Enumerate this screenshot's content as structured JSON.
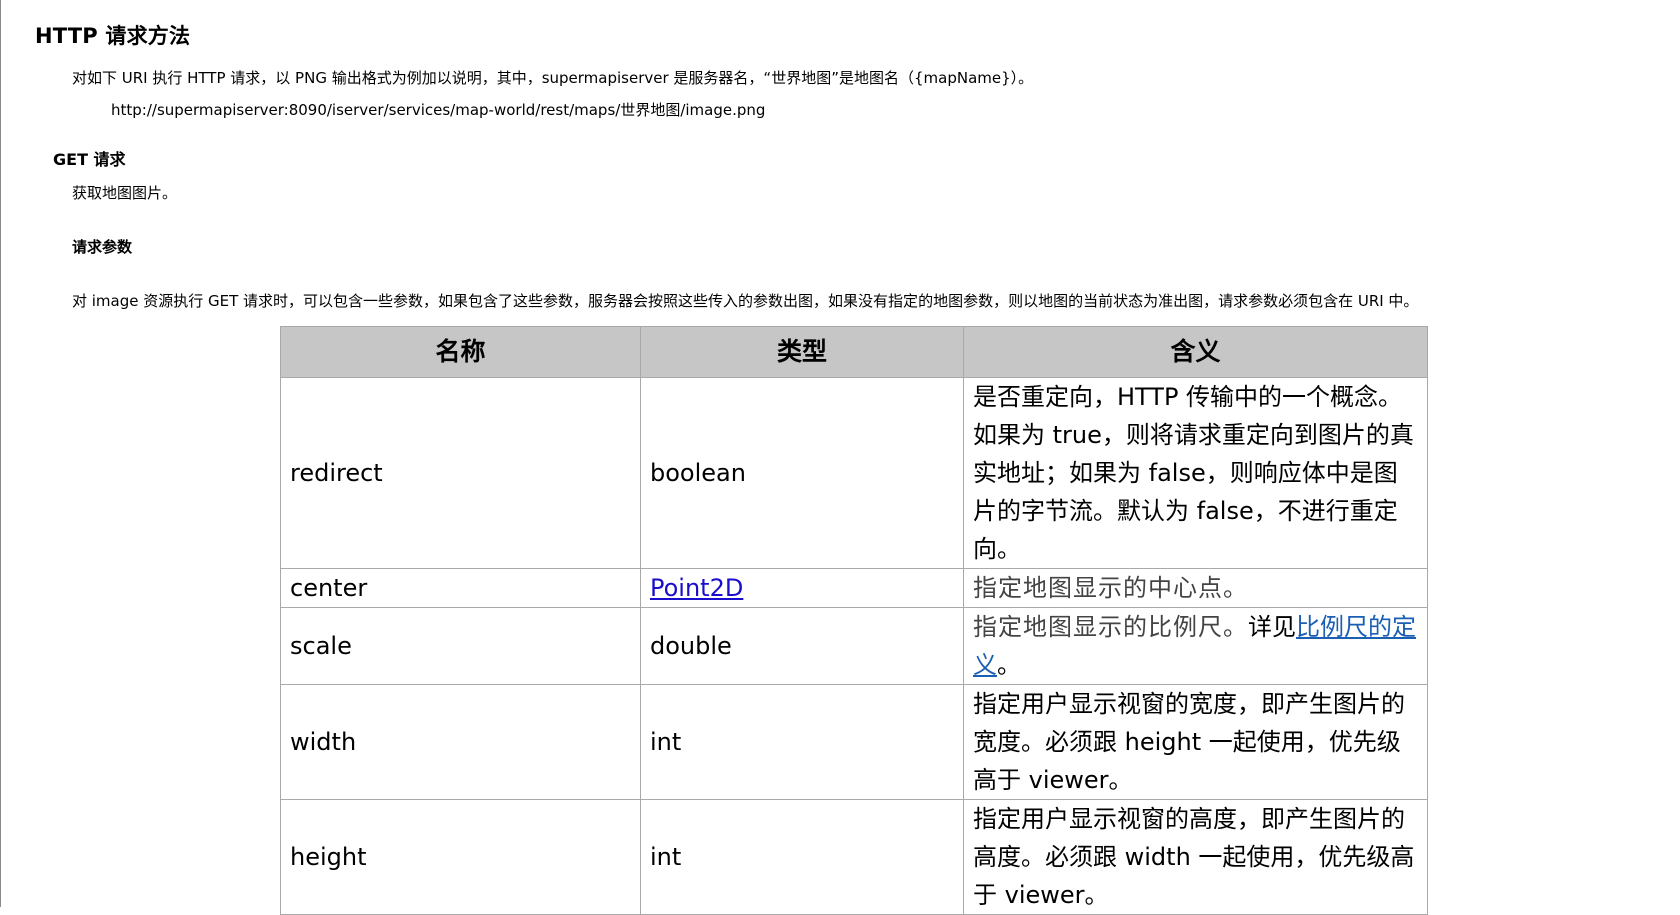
{
  "heading": "HTTP 请求方法",
  "intro": "对如下 URI 执行 HTTP 请求，以 PNG 输出格式为例加以说明，其中，supermapiserver 是服务器名，“世界地图”是地图名（{mapName}）。",
  "url": "http://supermapiserver:8090/iserver/services/map-world/rest/maps/世界地图/image.png",
  "get_section": {
    "title": "GET 请求",
    "desc": "获取地图图片。",
    "params_title": "请求参数",
    "params_desc": "对 image 资源执行 GET 请求时，可以包含一些参数，如果包含了这些参数，服务器会按照这些传入的参数出图，如果没有指定的地图参数，则以地图的当前状态为准出图，请求参数必须包含在 URI 中。"
  },
  "table": {
    "headers": [
      "名称",
      "类型",
      "含义"
    ],
    "rows": [
      {
        "name": "redirect",
        "type": "boolean",
        "desc": "是否重定向，HTTP 传输中的一个概念。如果为 true，则将请求重定向到图片的真实地址；如果为 false，则响应体中是图片的字节流。默认为 false，不进行重定向。"
      },
      {
        "name": "center",
        "type": "Point2D",
        "desc": "指定地图显示的中心点。"
      },
      {
        "name": "scale",
        "type": "double",
        "desc": "指定地图显示的比例尺。",
        "desc_suffix_pre": "详见",
        "desc_link": "比例尺的定义",
        "desc_suffix_post": "。"
      },
      {
        "name": "width",
        "type": "int",
        "desc": "指定用户显示视窗的宽度，即产生图片的宽度。必须跟 height 一起使用，优先级高于 viewer。"
      },
      {
        "name": "height",
        "type": "int",
        "desc": "指定用户显示视窗的高度，即产生图片的高度。必须跟 width 一起使用，优先级高于 viewer。"
      }
    ]
  }
}
